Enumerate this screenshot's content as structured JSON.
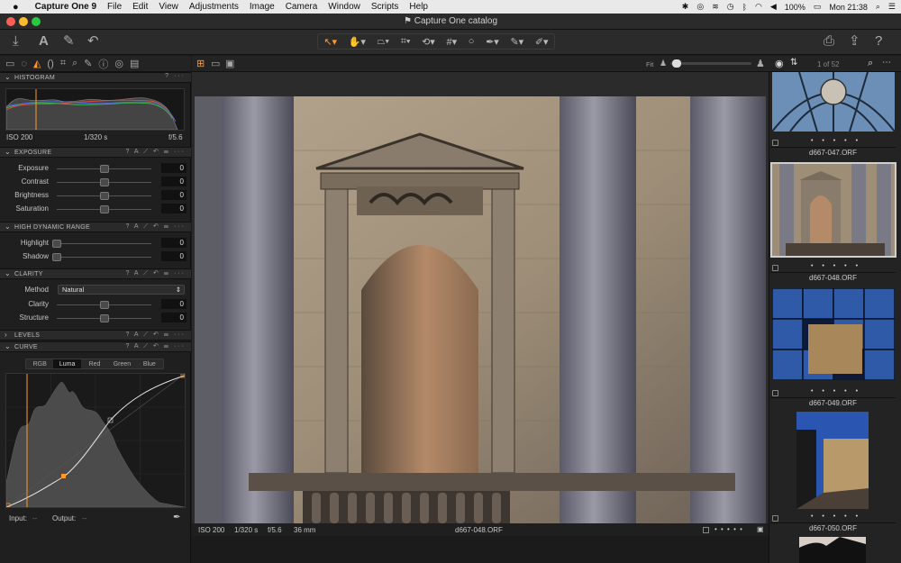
{
  "menubar": {
    "apple": "",
    "app_name": "Capture One 9",
    "items": [
      "File",
      "Edit",
      "View",
      "Adjustments",
      "Image",
      "Camera",
      "Window",
      "Scripts",
      "Help"
    ],
    "battery": "100%",
    "clock": "Mon 21:38"
  },
  "window": {
    "title": "Capture One catalog"
  },
  "tool_tabs": [
    "folder-icon",
    "camera-icon",
    "exposure-tab-icon",
    "lens-icon",
    "crop-icon",
    "search-icon",
    "brush-icon",
    "info-icon",
    "quality-icon",
    "list-icon"
  ],
  "exposure_eval": {
    "iso": "ISO 200",
    "shutter": "1/320 s",
    "aperture": "f/5.6"
  },
  "panels": {
    "histogram": "HISTOGRAM",
    "exposure": "EXPOSURE",
    "hdr": "HIGH DYNAMIC RANGE",
    "clarity": "CLARITY",
    "levels": "LEVELS",
    "curve": "CURVE"
  },
  "exposure": {
    "rows": [
      {
        "label": "Exposure",
        "value": "0",
        "level": 0.5
      },
      {
        "label": "Contrast",
        "value": "0",
        "level": 0.5
      },
      {
        "label": "Brightness",
        "value": "0",
        "level": 0.5
      },
      {
        "label": "Saturation",
        "value": "0",
        "level": 0.5
      }
    ]
  },
  "hdr": {
    "rows": [
      {
        "label": "Highlight",
        "value": "0",
        "level": 0.0
      },
      {
        "label": "Shadow",
        "value": "0",
        "level": 0.0
      }
    ]
  },
  "clarity": {
    "method_label": "Method",
    "method_value": "Natural",
    "rows": [
      {
        "label": "Clarity",
        "value": "0",
        "level": 0.5
      },
      {
        "label": "Structure",
        "value": "0",
        "level": 0.5
      }
    ]
  },
  "curve": {
    "tabs": [
      "RGB",
      "Luma",
      "Red",
      "Green",
      "Blue"
    ],
    "active_tab": "Luma",
    "input_label": "Input:",
    "input_value": "--",
    "output_label": "Output:",
    "output_value": "--"
  },
  "viewer": {
    "fit_label": "Fit",
    "counter": "1 of 52",
    "iso": "ISO 200",
    "shutter": "1/320 s",
    "aperture": "f/5.6",
    "focal": "36 mm",
    "filename": "d667-048.ORF",
    "rating": "• • • • •"
  },
  "browser": {
    "items": [
      {
        "name": "d667-047.ORF",
        "rating": "• • • • •"
      },
      {
        "name": "d667-048.ORF",
        "rating": "• • • • •",
        "selected": true
      },
      {
        "name": "d667-049.ORF",
        "rating": "• • • • •"
      },
      {
        "name": "d667-050.ORF",
        "rating": "• • • • •"
      }
    ]
  },
  "colors": {
    "accent": "#ff9a2a",
    "panel": "#1f1f1f",
    "header": "#2a2a2a"
  }
}
